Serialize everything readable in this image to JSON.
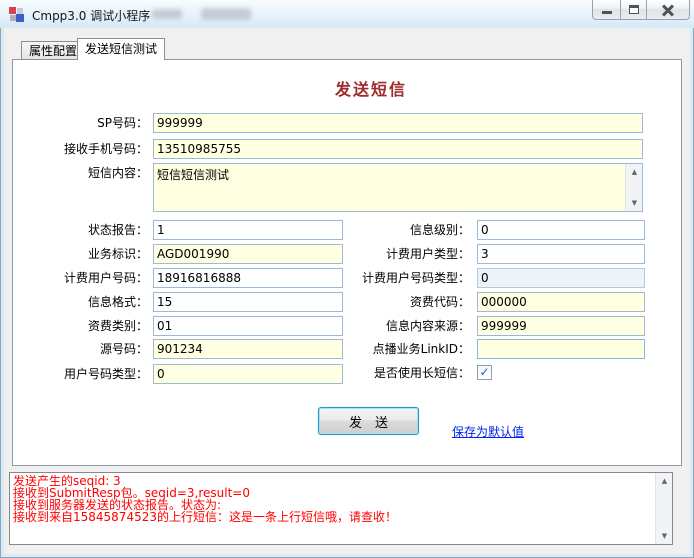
{
  "window": {
    "title": "Cmpp3.0 调试小程序",
    "controls": {
      "minimize": "minimize",
      "maximize": "maximize",
      "close": "close"
    }
  },
  "tabs": [
    {
      "label": "属性配置",
      "active": false
    },
    {
      "label": "发送短信测试",
      "active": true
    }
  ],
  "form": {
    "title": "发送短信",
    "fields": {
      "sp": {
        "label": "SP号码：",
        "value": "999999"
      },
      "phone": {
        "label": "接收手机号码：",
        "value": "13510985755"
      },
      "content": {
        "label": "短信内容：",
        "value": "短信短信测试"
      },
      "status_report": {
        "label": "状态报告：",
        "value": "1"
      },
      "msg_level": {
        "label": "信息级别：",
        "value": "0"
      },
      "service_id": {
        "label": "业务标识：",
        "value": "AGD001990"
      },
      "fee_user_type": {
        "label": "计费用户类型：",
        "value": "3"
      },
      "fee_number": {
        "label": "计费用户号码：",
        "value": "18916816888"
      },
      "fee_number_type": {
        "label": "计费用户号码类型：",
        "value": "0"
      },
      "msg_format": {
        "label": "信息格式：",
        "value": "15"
      },
      "fee_code": {
        "label": "资费代码：",
        "value": "000000"
      },
      "fee_type": {
        "label": "资费类别：",
        "value": "01"
      },
      "msg_src": {
        "label": "信息内容来源：",
        "value": "999999"
      },
      "src_number": {
        "label": "源号码：",
        "value": "901234"
      },
      "link_id": {
        "label": "点播业务LinkID：",
        "value": ""
      },
      "user_number_type": {
        "label": "用户号码类型：",
        "value": "0"
      },
      "long_sms": {
        "label": "是否使用长短信：",
        "checked": true
      }
    },
    "send_button": "发　送",
    "save_link": "保存为默认值"
  },
  "log": {
    "lines": [
      "发送产生的seqid: 3",
      "接收到SubmitResp包。seqid=3,result=0",
      "接收到服务器发送的状态报告。状态为:",
      "接收到来自15845874523的上行短信：这是一条上行短信哦，请查收！"
    ]
  },
  "icons": {
    "check": "✓",
    "scroll_up": "▲",
    "scroll_down": "▼"
  },
  "colors": {
    "form_title_red": "#9e2b2b",
    "log_red": "#ff0000",
    "link_blue": "#0023ee",
    "input_yellow": "#ffffe1",
    "titlebar_blue": "#e6f2fa"
  }
}
